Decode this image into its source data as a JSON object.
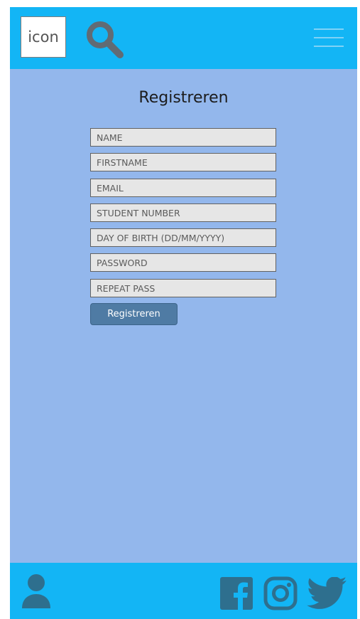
{
  "header": {
    "logo_text": "icon",
    "search_icon": "search-icon",
    "menu_icon": "hamburger-menu-icon"
  },
  "form": {
    "title": "Registreren",
    "fields": [
      {
        "name": "name",
        "placeholder": "NAME"
      },
      {
        "name": "firstname",
        "placeholder": "FIRSTNAME"
      },
      {
        "name": "email",
        "placeholder": "EMAIL"
      },
      {
        "name": "student_number",
        "placeholder": "STUDENT NUMBER"
      },
      {
        "name": "day_of_birth",
        "placeholder": "DAY OF BIRTH (DD/MM/YYYY)"
      },
      {
        "name": "password",
        "placeholder": "PASSWORD"
      },
      {
        "name": "repeat_pass",
        "placeholder": "REPEAT PASS"
      }
    ],
    "submit_label": "Registreren"
  },
  "footer": {
    "icons": [
      "user-icon",
      "facebook-icon",
      "instagram-icon",
      "twitter-icon"
    ]
  },
  "colors": {
    "header_footer_bg": "#13b5f5",
    "page_bg": "#93b7ec",
    "input_bg": "#e6e6e6",
    "button_bg": "#4f7ba4",
    "icon_gray": "#616b74",
    "footer_icon": "#2e6f8e"
  }
}
